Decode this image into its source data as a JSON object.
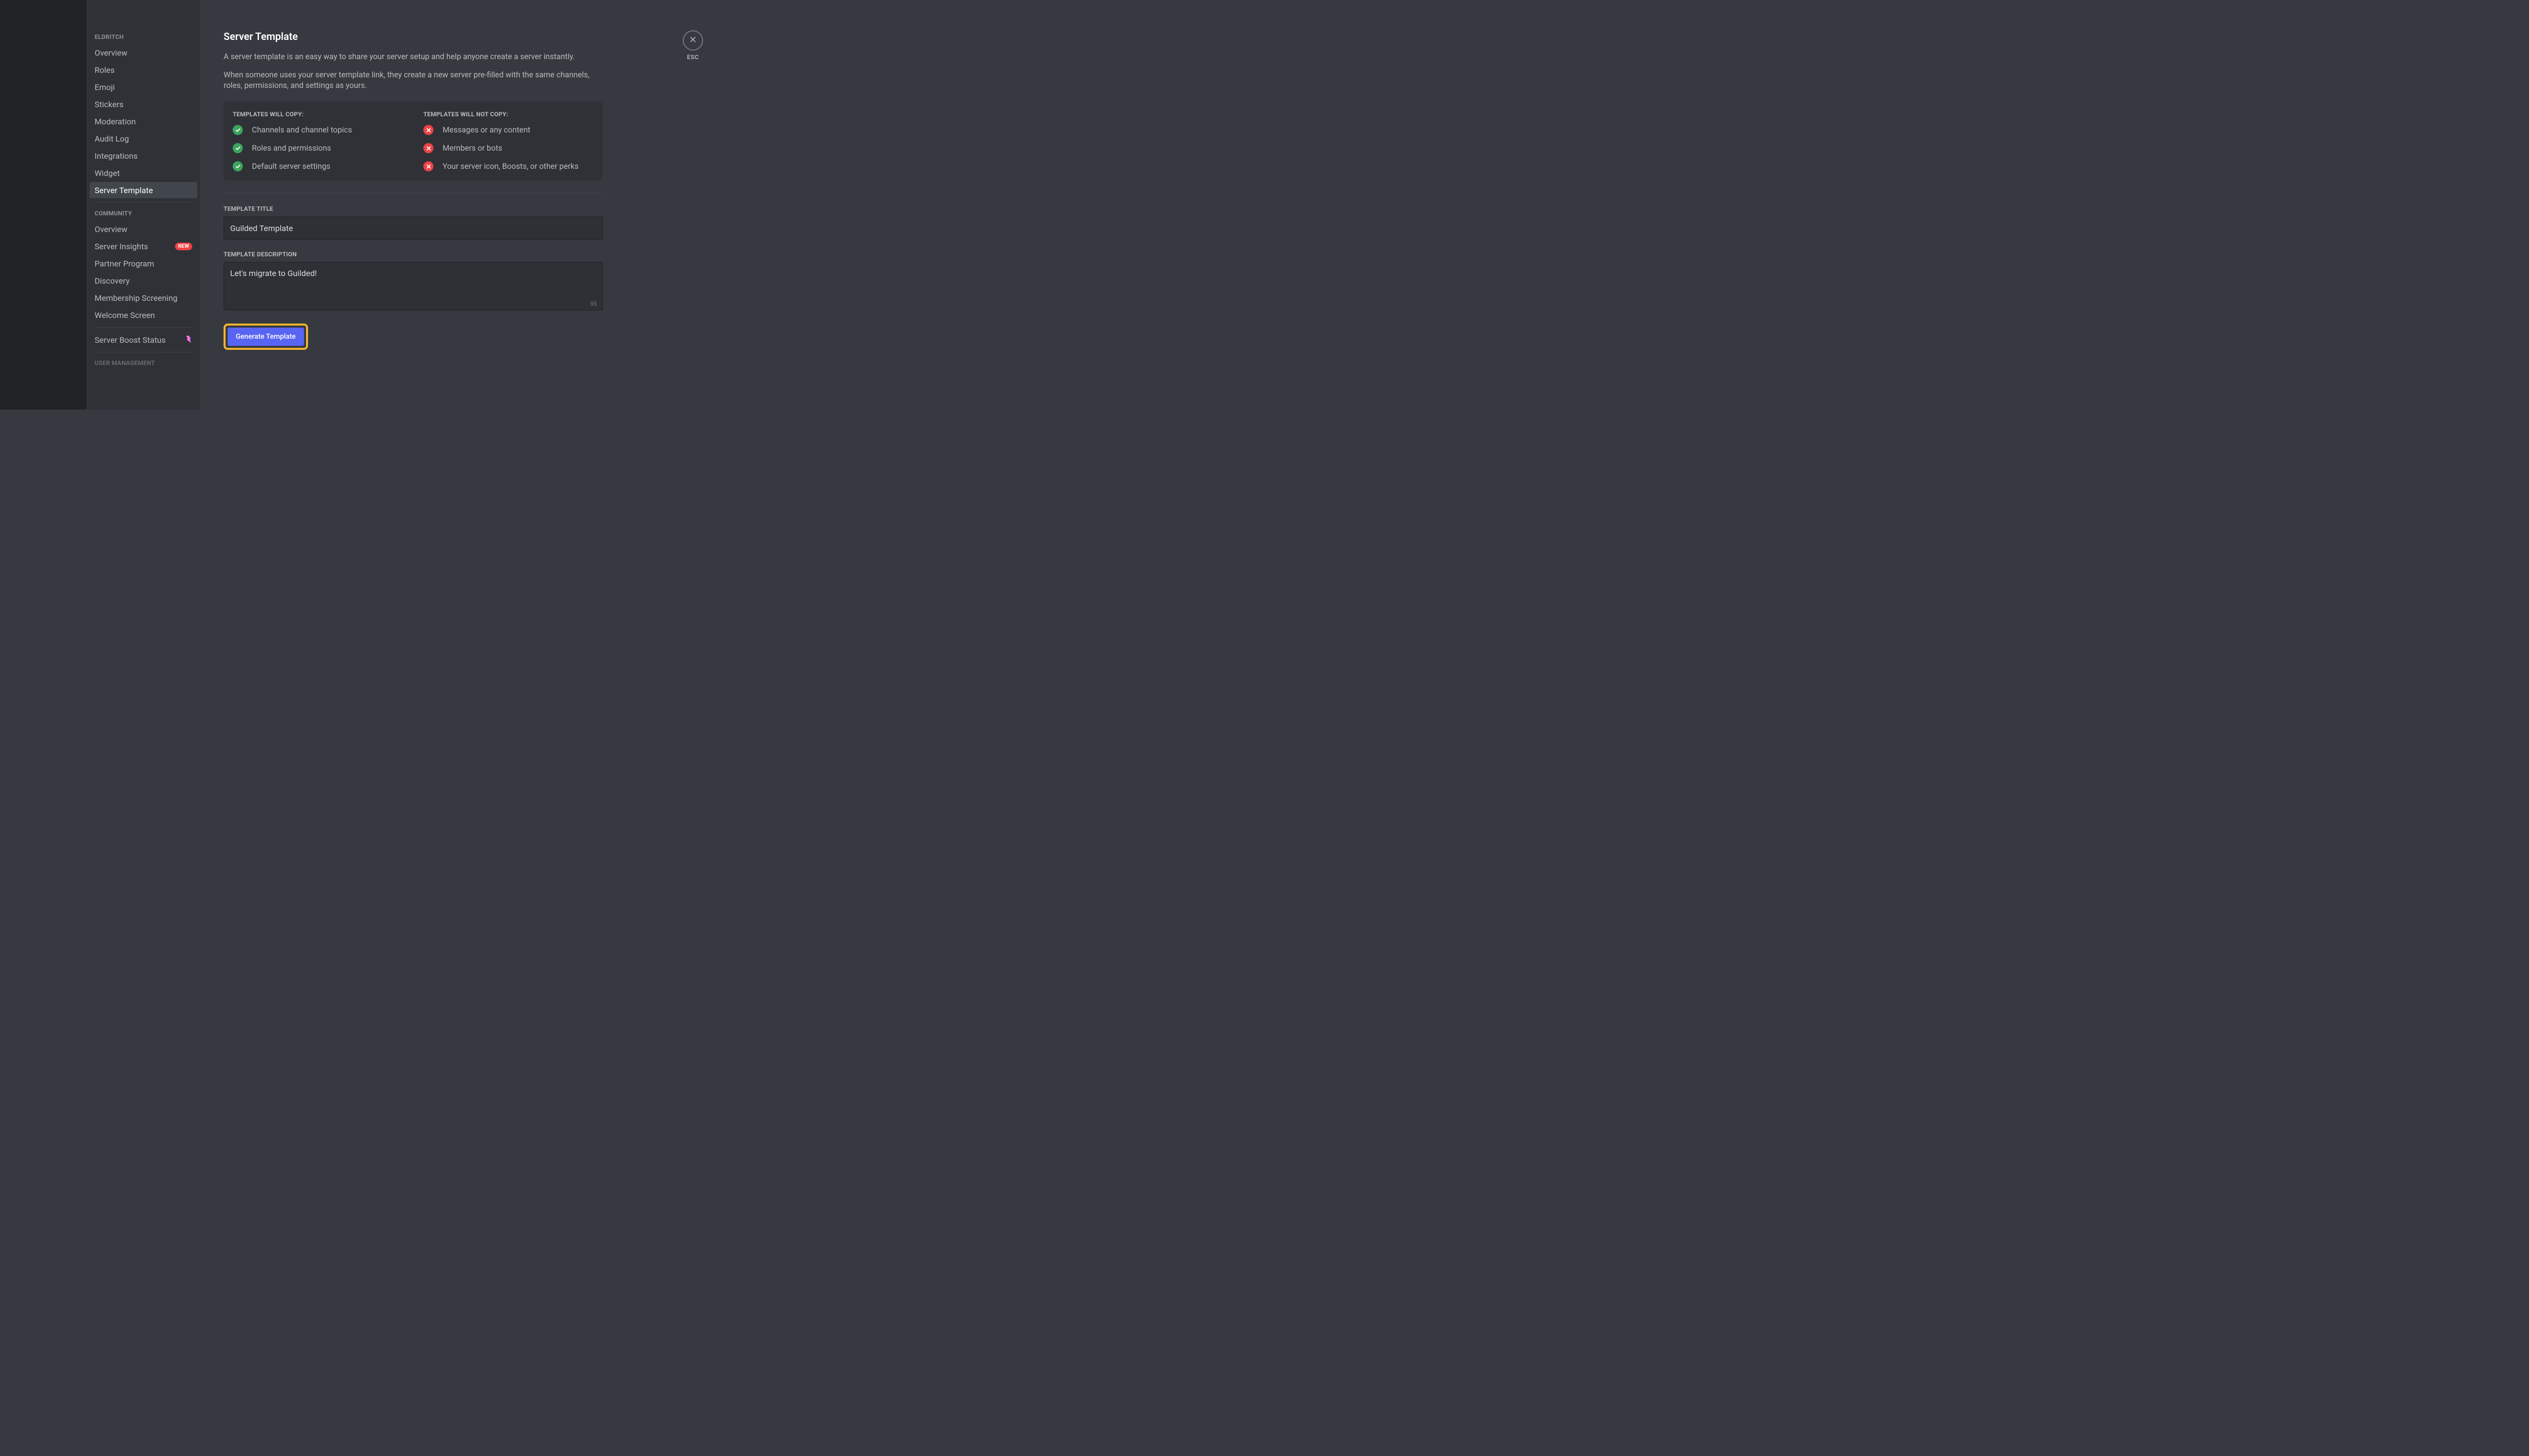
{
  "sidebar": {
    "section1_header": "ELDRITCH",
    "section1_items": [
      {
        "label": "Overview"
      },
      {
        "label": "Roles"
      },
      {
        "label": "Emoji"
      },
      {
        "label": "Stickers"
      },
      {
        "label": "Moderation"
      },
      {
        "label": "Audit Log"
      },
      {
        "label": "Integrations"
      },
      {
        "label": "Widget"
      },
      {
        "label": "Server Template"
      }
    ],
    "section2_header": "COMMUNITY",
    "section2_items": [
      {
        "label": "Overview"
      },
      {
        "label": "Server Insights",
        "badge": "NEW"
      },
      {
        "label": "Partner Program"
      },
      {
        "label": "Discovery"
      },
      {
        "label": "Membership Screening"
      },
      {
        "label": "Welcome Screen"
      }
    ],
    "boost_label": "Server Boost Status",
    "section3_header": "USER MANAGEMENT"
  },
  "page": {
    "title": "Server Template",
    "desc1": "A server template is an easy way to share your server setup and help anyone create a server instantly.",
    "desc2": "When someone uses your server template link, they create a new server pre-filled with the same channels, roles, permissions, and settings as yours.",
    "will_copy_title": "TEMPLATES WILL COPY:",
    "will_copy_items": [
      "Channels and channel topics",
      "Roles and permissions",
      "Default server settings"
    ],
    "wont_copy_title": "TEMPLATES WILL NOT COPY:",
    "wont_copy_items": [
      "Messages or any content",
      "Members or bots",
      "Your server icon, Boosts, or other perks"
    ],
    "form": {
      "title_label": "TEMPLATE TITLE",
      "title_value": "Guilded Template",
      "desc_label": "TEMPLATE DESCRIPTION",
      "desc_value": "Let's migrate to Guilded!",
      "char_count": "95",
      "button_label": "Generate Template"
    }
  },
  "close": {
    "label": "ESC"
  }
}
